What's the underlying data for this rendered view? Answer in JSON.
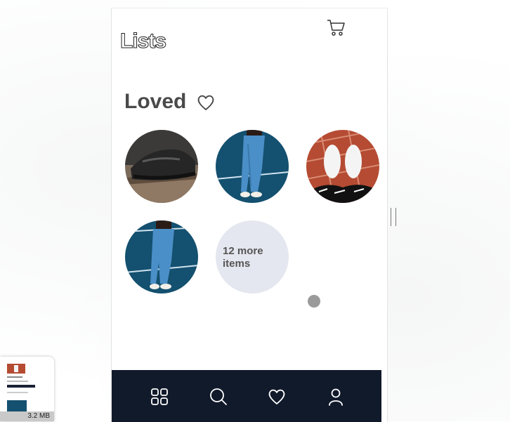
{
  "header": {
    "title": "Lists",
    "cart_icon": "cart-icon"
  },
  "section": {
    "title": "Loved",
    "icon": "heart-outline-icon"
  },
  "items": [
    {
      "name": "black-sneaker-on-bench",
      "colors": [
        "#6b5a4a",
        "#2a2a2a"
      ]
    },
    {
      "name": "blue-jeans-legs-1",
      "colors": [
        "#1c5a7f",
        "#4f93c8"
      ]
    },
    {
      "name": "white-sneakers-brick",
      "colors": [
        "#b3553d",
        "#f1f1f1"
      ]
    },
    {
      "name": "blue-jeans-legs-2",
      "colors": [
        "#1c5a7f",
        "#4f93c8"
      ]
    }
  ],
  "more": {
    "label": "12 more items"
  },
  "tabbar": {
    "background": "#111a2b",
    "tabs": [
      {
        "icon": "grid-icon"
      },
      {
        "icon": "search-icon"
      },
      {
        "icon": "heart-icon"
      },
      {
        "icon": "profile-icon"
      }
    ]
  },
  "thumbnail": {
    "size_label": "3.2 MB"
  }
}
